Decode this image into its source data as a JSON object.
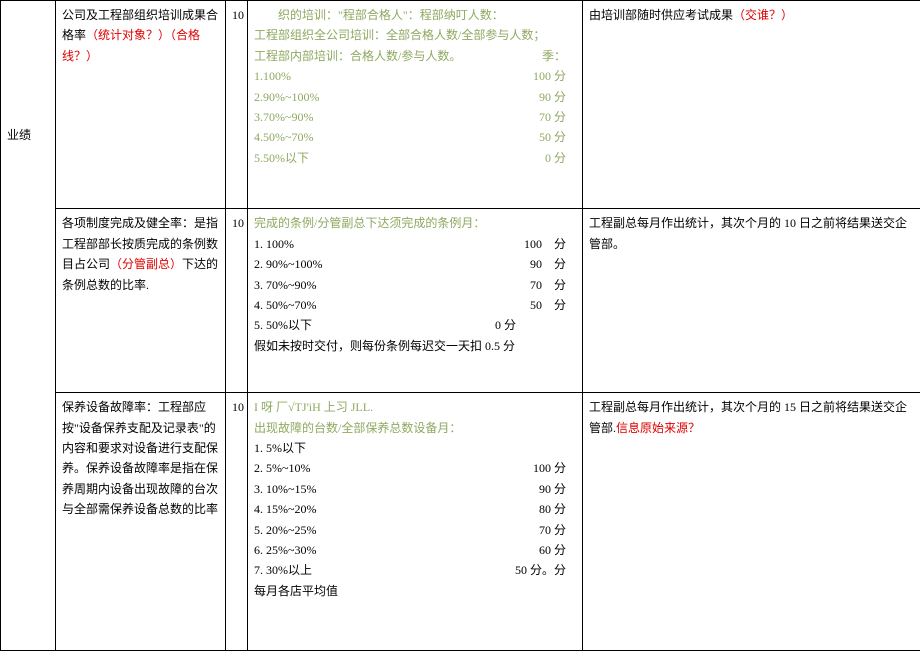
{
  "rowA": {
    "category": "",
    "desc_main": "公司及工程部组织培训成果合格率",
    "desc_red": "（统计对象？）（合格线？）",
    "weight": "10",
    "header_green": "织的培训：\"程部合格人\"：程部纳叮人数：",
    "line1": "工程部组织全公司培训：全部合格人数/全部参与人数；",
    "line2": "工程部内部培训：合格人数/参与人数。",
    "line2_suffix": "季：",
    "scores": [
      {
        "label": "1.100%",
        "pts": "100 分"
      },
      {
        "label": "2.90%~100%",
        "pts": "90 分"
      },
      {
        "label": "3.70%~90%",
        "pts": "70 分"
      },
      {
        "label": "4.50%~70%",
        "pts": "50 分"
      },
      {
        "label": "5.50%以下",
        "pts": "0 分"
      }
    ],
    "source_main": "由培训部随时供应考试成果",
    "source_red": "（交谁？）"
  },
  "rowB": {
    "category": "业绩",
    "desc_main_a": "各项制度完成及健全率：是指工程部部长按质完成的条例数目占公司",
    "desc_red": "（分管副总）",
    "desc_main_b": "下达的条例总数的比率.",
    "weight": "10",
    "header_green": "完成的条例/分管副总下达须完成的条例月：",
    "scores": [
      {
        "label": "1. 100%",
        "pts": "100　分"
      },
      {
        "label": "2. 90%~100%",
        "pts": "90　分"
      },
      {
        "label": "3. 70%~90%",
        "pts": "70　分"
      },
      {
        "label": "4. 50%~70%",
        "pts": "50　分"
      },
      {
        "label": "5. 50%以下",
        "pts": "0 分"
      }
    ],
    "penalty": "假如未按时交付，则每份条例每迟交一天扣 0.5 分",
    "source": "工程副总每月作出统计，其次个月的 10 日之前将结果送交企管部。"
  },
  "rowC": {
    "desc_main": "保养设备故障率：工程部应按\"设备保养支配及记录表\"的内容和要求对设备进行支配保养。保养设备故障率是指在保养周期内设备出现故障的台次与全部需保养设备总数的比率",
    "weight": "10",
    "header_green_a": "I 呀 厂√TJ'iH 上习 JLL.",
    "header_green_b": "出现故障的台数/全部保养总数设备月：",
    "scores": [
      {
        "label": "1. 5%以下",
        "pts": ""
      },
      {
        "label": "2. 5%~10%",
        "pts": "100 分"
      },
      {
        "label": "3. 10%~15%",
        "pts": "90 分"
      },
      {
        "label": "4. 15%~20%",
        "pts": "80 分"
      },
      {
        "label": "5. 20%~25%",
        "pts": "70 分"
      },
      {
        "label": "6. 25%~30%",
        "pts": "60 分"
      },
      {
        "label": "7. 30%以上",
        "pts": "50 分。分"
      }
    ],
    "footer": "每月各店平均值",
    "source_main": "工程副总每月作出统计，其次个月的 15 日之前将结果送交企管部.",
    "source_red": "信息原始来源？"
  }
}
